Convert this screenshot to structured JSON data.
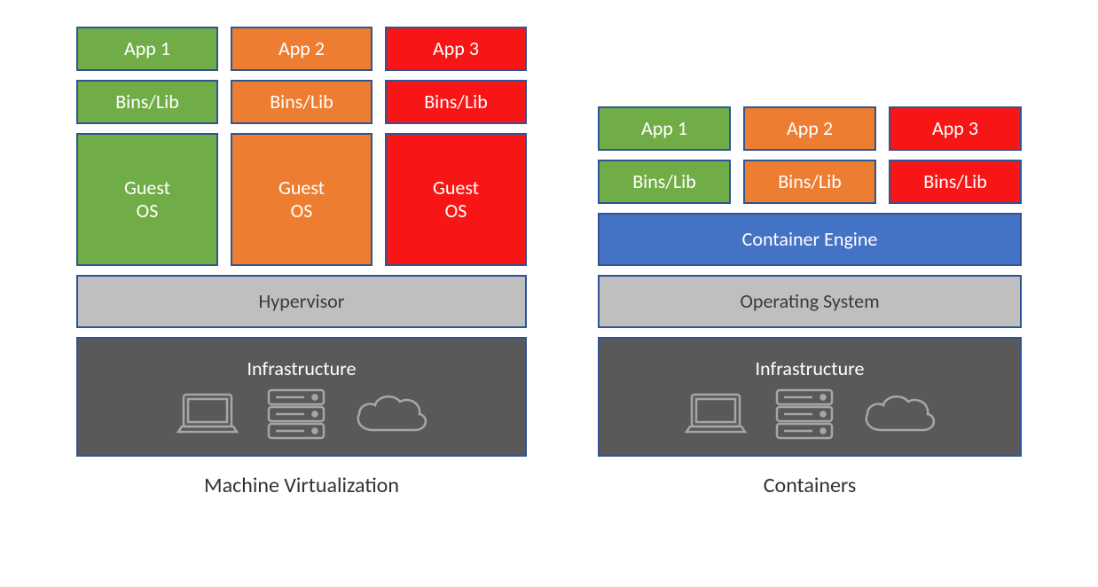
{
  "vm": {
    "title": "Machine Virtualization",
    "cols": [
      {
        "app": "App 1",
        "bins": "Bins/Lib",
        "os": "Guest\nOS",
        "color": "green"
      },
      {
        "app": "App 2",
        "bins": "Bins/Lib",
        "os": "Guest\nOS",
        "color": "orange"
      },
      {
        "app": "App 3",
        "bins": "Bins/Lib",
        "os": "Guest\nOS",
        "color": "red"
      }
    ],
    "hypervisor": "Hypervisor",
    "infra": "Infrastructure"
  },
  "containers": {
    "title": "Containers",
    "cols": [
      {
        "app": "App 1",
        "bins": "Bins/Lib",
        "color": "green"
      },
      {
        "app": "App 2",
        "bins": "Bins/Lib",
        "color": "orange"
      },
      {
        "app": "App 3",
        "bins": "Bins/Lib",
        "color": "red"
      }
    ],
    "engine": "Container Engine",
    "os": "Operating System",
    "infra": "Infrastructure"
  },
  "icons": {
    "laptop": "laptop-icon",
    "server": "server-icon",
    "cloud": "cloud-icon"
  }
}
